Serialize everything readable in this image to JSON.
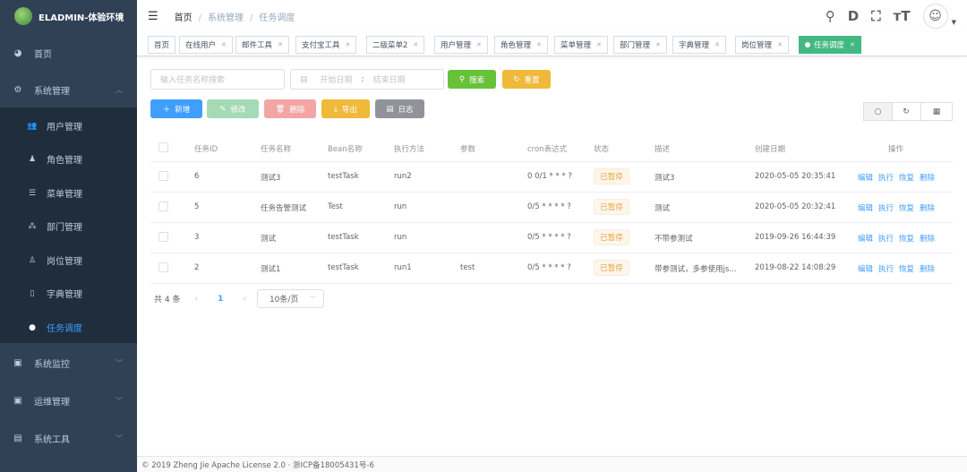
{
  "app": {
    "title": "ELADMIN-体验环境"
  },
  "sidebar": {
    "top": [
      {
        "label": "首页",
        "icon": "dashboard-icon"
      },
      {
        "label": "系统管理",
        "icon": "gear-icon"
      }
    ],
    "sub": [
      {
        "label": "用户管理"
      },
      {
        "label": "角色管理"
      },
      {
        "label": "菜单管理"
      },
      {
        "label": "部门管理"
      },
      {
        "label": "岗位管理"
      },
      {
        "label": "字典管理"
      },
      {
        "label": "任务调度"
      }
    ],
    "bottom": [
      {
        "label": "系统监控"
      },
      {
        "label": "运维管理"
      },
      {
        "label": "系统工具"
      }
    ]
  },
  "breadcrumb": [
    "首页",
    "系统管理",
    "任务调度"
  ],
  "tags": [
    "首页",
    "在线用户",
    "邮件工具",
    "支付宝工具",
    "二级菜单2",
    "用户管理",
    "角色管理",
    "菜单管理",
    "部门管理",
    "字典管理",
    "岗位管理",
    "任务调度"
  ],
  "filters": {
    "search_placeholder": "输入任务名称搜索",
    "start_placeholder": "开始日期",
    "range_sep": ":",
    "end_placeholder": "结束日期",
    "search_label": "搜索",
    "reset_label": "重置"
  },
  "toolbar": {
    "add": "新增",
    "edit": "修改",
    "delete": "删除",
    "export": "导出",
    "log": "日志"
  },
  "table": {
    "headers": [
      "任务ID",
      "任务名称",
      "Bean名称",
      "执行方法",
      "参数",
      "cron表达式",
      "状态",
      "描述",
      "创建日期",
      "操作"
    ],
    "rows": [
      {
        "id": "6",
        "name": "测试3",
        "bean": "testTask",
        "method": "run2",
        "params": "",
        "cron": "0 0/1 * * * ?",
        "status": "已暂停",
        "desc": "测试3",
        "created": "2020-05-05 20:35:41"
      },
      {
        "id": "5",
        "name": "任务告警测试",
        "bean": "Test",
        "method": "run",
        "params": "",
        "cron": "0/5 * * * * ?",
        "status": "已暂停",
        "desc": "测试",
        "created": "2020-05-05 20:32:41"
      },
      {
        "id": "3",
        "name": "测试",
        "bean": "testTask",
        "method": "run",
        "params": "",
        "cron": "0/5 * * * * ?",
        "status": "已暂停",
        "desc": "不带参测试",
        "created": "2019-09-26 16:44:39"
      },
      {
        "id": "2",
        "name": "测试1",
        "bean": "testTask",
        "method": "run1",
        "params": "test",
        "cron": "0/5 * * * * ?",
        "status": "已暂停",
        "desc": "带参测试，多参使用js...",
        "created": "2019-08-22 14:08:29"
      }
    ],
    "ops": [
      "编辑",
      "执行",
      "恢复",
      "删除"
    ]
  },
  "pagination": {
    "total": "共 4 条",
    "page": "1",
    "size": "10条/页"
  },
  "footer": "© 2019 Zheng Jie Apache License 2.0 · 浙ICP备18005431号-6"
}
